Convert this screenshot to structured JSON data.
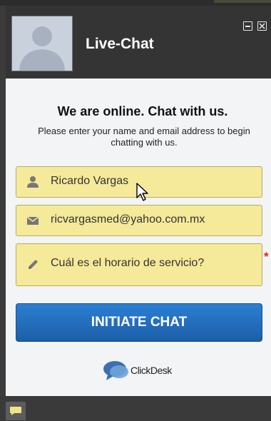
{
  "header": {
    "title": "Live-Chat",
    "minimize_icon": "minimize-icon",
    "close_icon": "close-icon"
  },
  "main": {
    "headline": "We are online. Chat with us.",
    "subtext": "Please enter your name and email address to begin chatting with us."
  },
  "form": {
    "name": {
      "value": "Ricardo Vargas",
      "icon": "user-icon"
    },
    "email": {
      "value": "ricvargasmed@yahoo.com.mx",
      "icon": "envelope-icon"
    },
    "message": {
      "value": "Cuál es el horario de servicio?",
      "icon": "pencil-icon",
      "required_mark": "*"
    }
  },
  "cta": {
    "label": "INITIATE CHAT"
  },
  "brand": {
    "name": "ClickDesk"
  },
  "colors": {
    "field_bg": "#f5e99a",
    "button_blue": "#1c5ea7",
    "header_bg": "#343434",
    "required": "#e02020"
  }
}
